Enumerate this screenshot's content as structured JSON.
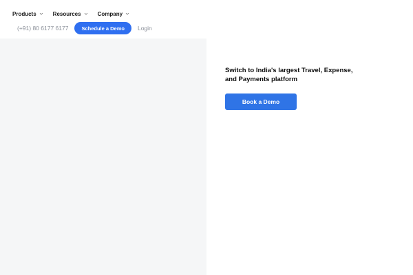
{
  "nav": {
    "items": [
      {
        "label": "Products"
      },
      {
        "label": "Resources"
      },
      {
        "label": "Company"
      }
    ]
  },
  "actions": {
    "phone": "(+91) 80 6177 6177",
    "schedule_label": "Schedule a Demo",
    "login_label": "Login"
  },
  "hero": {
    "headline": "Switch to India's largest Travel, Expense, and Payments platform",
    "cta_label": "Book a Demo"
  },
  "colors": {
    "accent": "#2f74e6",
    "pill": "#2f6ff0",
    "muted_text": "#8a8f98",
    "panel_bg": "#f5f6f7"
  }
}
